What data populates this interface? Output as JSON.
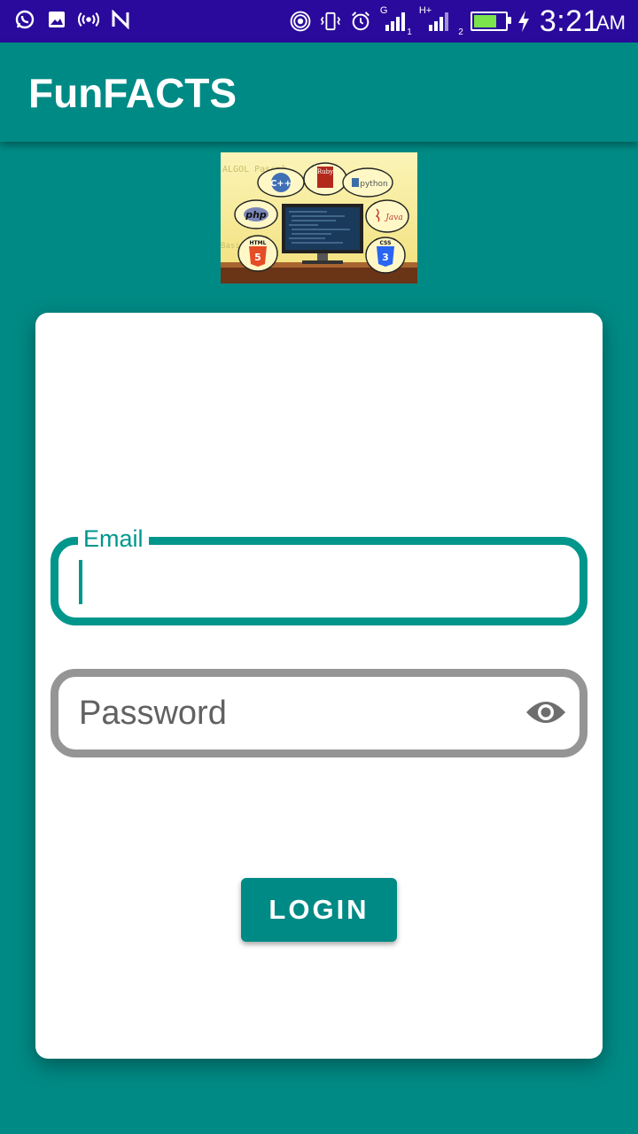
{
  "status_bar": {
    "time": "3:21",
    "ampm": "AM",
    "battery_level": 0.75,
    "left_icons": [
      "whatsapp-icon",
      "gallery-icon",
      "hotspot-icon",
      "n-icon"
    ],
    "right_icons": [
      "wireless-icon",
      "vibrate-icon",
      "alarm-icon",
      "signal-1-icon",
      "signal-2-icon",
      "battery-icon",
      "charging-icon"
    ],
    "sim1_tech": "G",
    "sim1_slot": "1",
    "sim2_tech": "H+",
    "sim2_slot": "2"
  },
  "app_bar": {
    "title": "FunFACTS"
  },
  "banner": {
    "labels": {
      "cpp": "C++",
      "ruby": "Ruby",
      "python": "python",
      "php": "php",
      "java": "Java",
      "html": "HTML",
      "css": "CSS"
    }
  },
  "form": {
    "email_label": "Email",
    "email_value": "",
    "password_placeholder": "Password",
    "login_label": "LOGIN"
  },
  "colors": {
    "primary": "#008a85",
    "accent": "#00968c",
    "status_bar": "#2a0a9c"
  }
}
